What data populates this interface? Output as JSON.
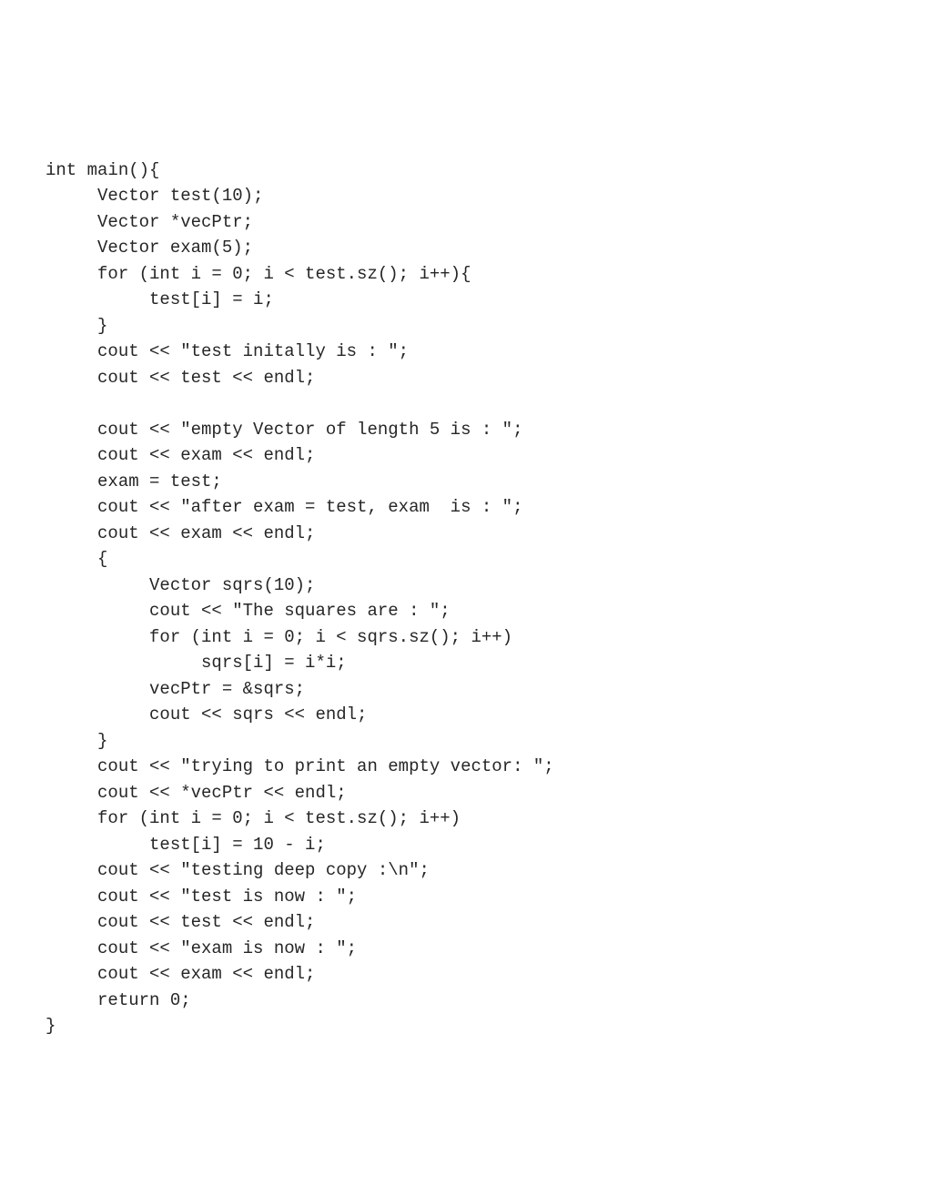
{
  "code": {
    "lines": [
      "int main(){",
      "     Vector test(10);",
      "     Vector *vecPtr;",
      "     Vector exam(5);",
      "     for (int i = 0; i < test.sz(); i++){",
      "          test[i] = i;",
      "     }",
      "     cout << \"test initally is : \";",
      "     cout << test << endl;",
      "",
      "     cout << \"empty Vector of length 5 is : \";",
      "     cout << exam << endl;",
      "     exam = test;",
      "     cout << \"after exam = test, exam  is : \";",
      "     cout << exam << endl;",
      "     {",
      "          Vector sqrs(10);",
      "          cout << \"The squares are : \";",
      "          for (int i = 0; i < sqrs.sz(); i++)",
      "               sqrs[i] = i*i;",
      "          vecPtr = &sqrs;",
      "          cout << sqrs << endl;",
      "     }",
      "     cout << \"trying to print an empty vector: \";",
      "     cout << *vecPtr << endl;",
      "     for (int i = 0; i < test.sz(); i++)",
      "          test[i] = 10 - i;",
      "     cout << \"testing deep copy :\\n\";",
      "     cout << \"test is now : \";",
      "     cout << test << endl;",
      "     cout << \"exam is now : \";",
      "     cout << exam << endl;",
      "     return 0;",
      "}"
    ]
  }
}
